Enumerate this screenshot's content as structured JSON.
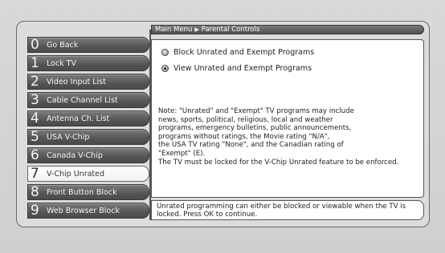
{
  "header": {
    "breadcrumb_root": "Main Menu",
    "breadcrumb_current": "Parental Controls"
  },
  "menu": {
    "items": [
      {
        "num": "0",
        "label": "Go Back"
      },
      {
        "num": "1",
        "label": "Lock TV"
      },
      {
        "num": "2",
        "label": "Video Input List"
      },
      {
        "num": "3",
        "label": "Cable Channel List"
      },
      {
        "num": "4",
        "label": "Antenna Ch. List"
      },
      {
        "num": "5",
        "label": "USA V-Chip"
      },
      {
        "num": "6",
        "label": "Canada V-Chip"
      },
      {
        "num": "7",
        "label": "V-Chip Unrated"
      },
      {
        "num": "8",
        "label": "Front Button Block"
      },
      {
        "num": "9",
        "label": "Web Browser Block"
      }
    ],
    "selected_index": 7
  },
  "options": {
    "block_label": "Block Unrated and Exempt Programs",
    "view_label": "View Unrated and Exempt Programs",
    "selected": "view"
  },
  "note": {
    "text": "Note: \"Unrated\" and \"Exempt\" TV programs may include\nnews, sports, political, religious, local and weather\nprograms, emergency bulletins, public announcements,\nprograms without ratings, the Movie rating \"N/A\",\nthe USA TV rating \"None\", and the Canadian rating of\n\"Exempt\" (E).",
    "lock_text": "The TV must be locked for the V-Chip Unrated feature to be enforced."
  },
  "status": {
    "text": "Unrated programming can either be blocked or viewable when the TV is locked. Press OK to continue."
  }
}
